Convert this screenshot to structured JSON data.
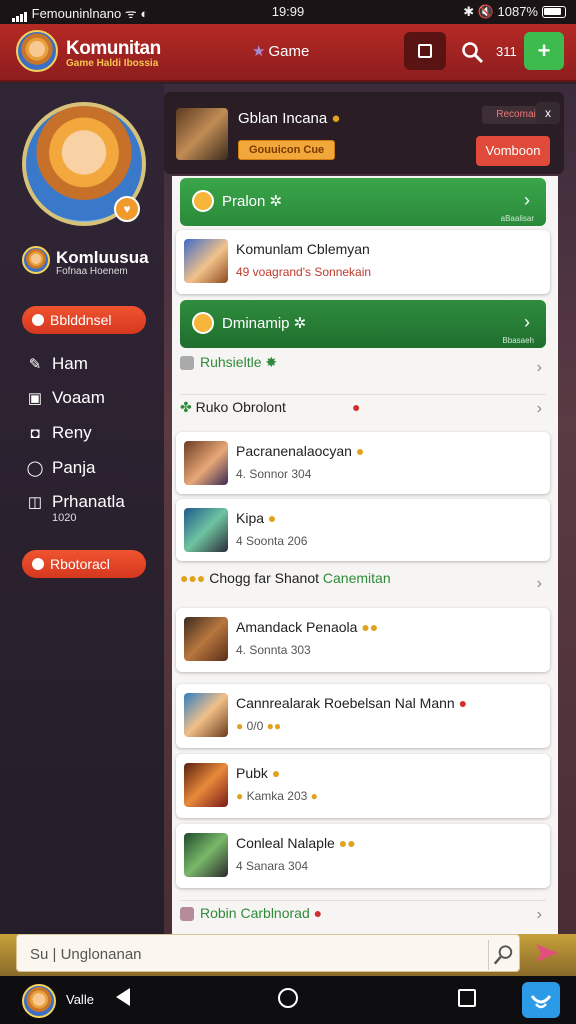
{
  "status": {
    "carrier": "Femouninlnano",
    "time": "19:99",
    "battery": "1087%"
  },
  "header": {
    "title": "Komunitan",
    "subtitle": "Game Haldi Ibossia",
    "game_tab": "Game",
    "count": "311",
    "add_label": "+"
  },
  "sidebar": {
    "user_name": "Komluusua",
    "user_sub": "Fofnaa Hoenem",
    "pill_top": "Bblddnsel",
    "pill_bottom": "Rbotoracl",
    "nav": [
      {
        "label": "Ham",
        "icon": "pin-icon"
      },
      {
        "label": "Voaam",
        "icon": "chat-icon"
      },
      {
        "label": "Reny",
        "icon": "shield-icon"
      },
      {
        "label": "Panja",
        "icon": "ring-icon"
      },
      {
        "label": "Prhanatla",
        "icon": "box-icon"
      }
    ],
    "nav_sub": "1020"
  },
  "notification": {
    "title": "Gblan Incana",
    "tag": "Gouuicon Cue",
    "mini": "Recomai",
    "close": "x",
    "action": "Vomboon"
  },
  "list": {
    "section1": {
      "title": "Pralon",
      "meta": "aBaalisar"
    },
    "card1": {
      "title": "Komunlam Cblemyan",
      "sub": "49 voagrand's Sonnekain"
    },
    "section2": {
      "title": "Dminamip",
      "meta": "Bbasaeh"
    },
    "row1": {
      "label": "Ruhsieltle"
    },
    "row2": {
      "label": "Ruko Obrolont"
    },
    "card2": {
      "title": "Pacranenalaocyan",
      "sub": "4. Sonnor 304"
    },
    "card3": {
      "title": "Kipa",
      "sub": "4 Soonta 206"
    },
    "row3": {
      "label": "Chogg far Shanot",
      "extra": "Canemitan"
    },
    "card4": {
      "title": "Amandack Penaola",
      "sub": "4. Sonnta 303"
    },
    "card5": {
      "title": "Cannrealarak Roebelsan Nal Mann",
      "sub": "0/0"
    },
    "card6": {
      "title": "Pubk",
      "sub": "Kamka 203"
    },
    "card7": {
      "title": "Conleal Nalaple",
      "sub": "4 Sanara 304"
    },
    "row4": {
      "label": "Robin Carblnorad"
    }
  },
  "search": {
    "placeholder": "Unglonanan",
    "prefix": "Su"
  },
  "navbar": {
    "label": "Valle"
  }
}
